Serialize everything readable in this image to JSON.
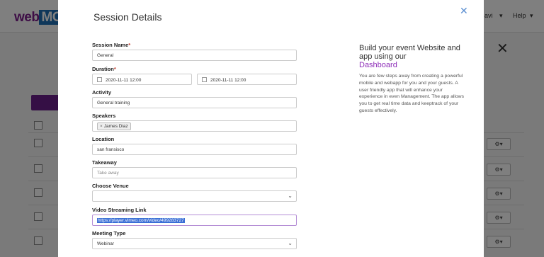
{
  "background": {
    "logo_brand": "web",
    "logo_rest": "MOB",
    "nav_user": "avi",
    "nav_help": "Help",
    "close_icon": "close-icon",
    "gear_button_label": "⚙▾"
  },
  "modal": {
    "title": "Session Details",
    "close_icon": "close-icon"
  },
  "form": {
    "session_name": {
      "label": "Session Name",
      "required": "*",
      "value": "General"
    },
    "duration": {
      "label": "Duration",
      "required": "*",
      "start": "2020-11-11 12:00",
      "end": "2020-11-11 12:00"
    },
    "activity": {
      "label": "Activity",
      "value": "General training"
    },
    "speakers": {
      "label": "Speakers",
      "tag": "James Diaz",
      "tag_remove": "×"
    },
    "location": {
      "label": "Location",
      "value": "san fransisco"
    },
    "takeaway": {
      "label": "Takeaway",
      "placeholder": "Take away"
    },
    "venue": {
      "label": "Choose Venue",
      "value": ""
    },
    "video_link": {
      "label": "Video Streaming Link",
      "value": "https://player.vimeo.com/video/499283727"
    },
    "meeting_type": {
      "label": "Meeting Type",
      "value": "Webinar"
    }
  },
  "promo": {
    "heading": "Build your event Website and app using our",
    "link": "Dashboard",
    "body": "You are few steps away from creating a powerful mobile and webapp for you and your guests. A user friendly app that will enhance your experience in even Management. The app allows you to get real time data and keeptrack of your guests effectively."
  },
  "colors": {
    "accent_purple": "#8e2eb8",
    "close_blue": "#5b8fd1",
    "selection_blue": "#3b6fd6"
  }
}
